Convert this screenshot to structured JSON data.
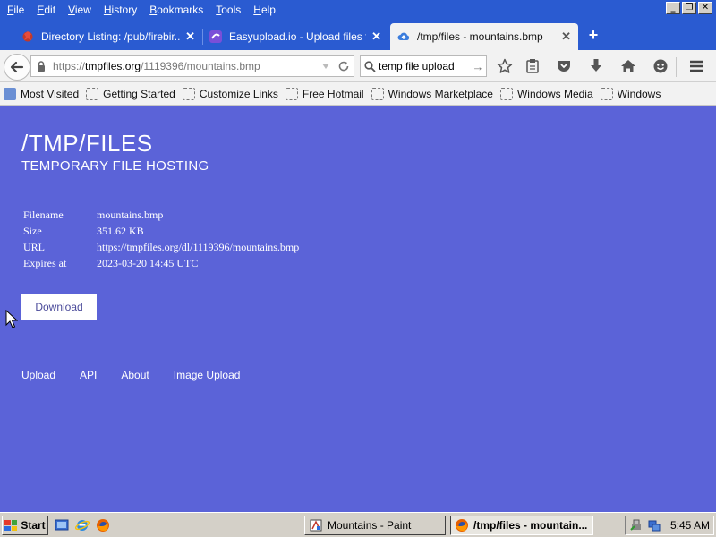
{
  "menu": {
    "items": [
      {
        "key": "F",
        "rest": "ile"
      },
      {
        "key": "E",
        "rest": "dit"
      },
      {
        "key": "V",
        "rest": "iew"
      },
      {
        "key": "H",
        "rest": "istory"
      },
      {
        "key": "B",
        "rest": "ookmarks"
      },
      {
        "key": "T",
        "rest": "ools"
      },
      {
        "key": "H",
        "rest": "elp"
      }
    ]
  },
  "window_controls": {
    "minimize": "_",
    "restore": "❐",
    "close": "✕"
  },
  "tabs": [
    {
      "title": "Directory Listing: /pub/firebir...",
      "close": "✕"
    },
    {
      "title": "Easyupload.io - Upload files f...",
      "close": "✕"
    },
    {
      "title": "/tmp/files - mountains.bmp",
      "close": "✕"
    }
  ],
  "new_tab": "+",
  "urlbar": {
    "prefix": "https://",
    "host": "tmpfiles.org",
    "path": "/1119396/mountains.bmp"
  },
  "searchbar": {
    "value": "temp file upload"
  },
  "bookmarks": [
    "Most Visited",
    "Getting Started",
    "Customize Links",
    "Free Hotmail",
    "Windows Marketplace",
    "Windows Media",
    "Windows"
  ],
  "page": {
    "title": "/TMP/FILES",
    "subtitle": "TEMPORARY FILE HOSTING",
    "info": [
      {
        "key": "Filename",
        "value": "mountains.bmp"
      },
      {
        "key": "Size",
        "value": "351.62 KB"
      },
      {
        "key": "URL",
        "value": "https://tmpfiles.org/dl/1119396/mountains.bmp"
      },
      {
        "key": "Expires at",
        "value": "2023-03-20 14:45 UTC"
      }
    ],
    "download_label": "Download",
    "footer_links": [
      "Upload",
      "API",
      "About",
      "Image Upload"
    ]
  },
  "taskbar": {
    "start_label": "Start",
    "tasks": [
      {
        "label": "Mountains - Paint"
      },
      {
        "label": "/tmp/files - mountain..."
      }
    ],
    "clock": "5:45 AM"
  },
  "colors": {
    "page_background": "#5b63d8",
    "titlebar": "#2a5bd1",
    "chrome": "#f2f2f2",
    "taskbar": "#d4d0c8"
  }
}
